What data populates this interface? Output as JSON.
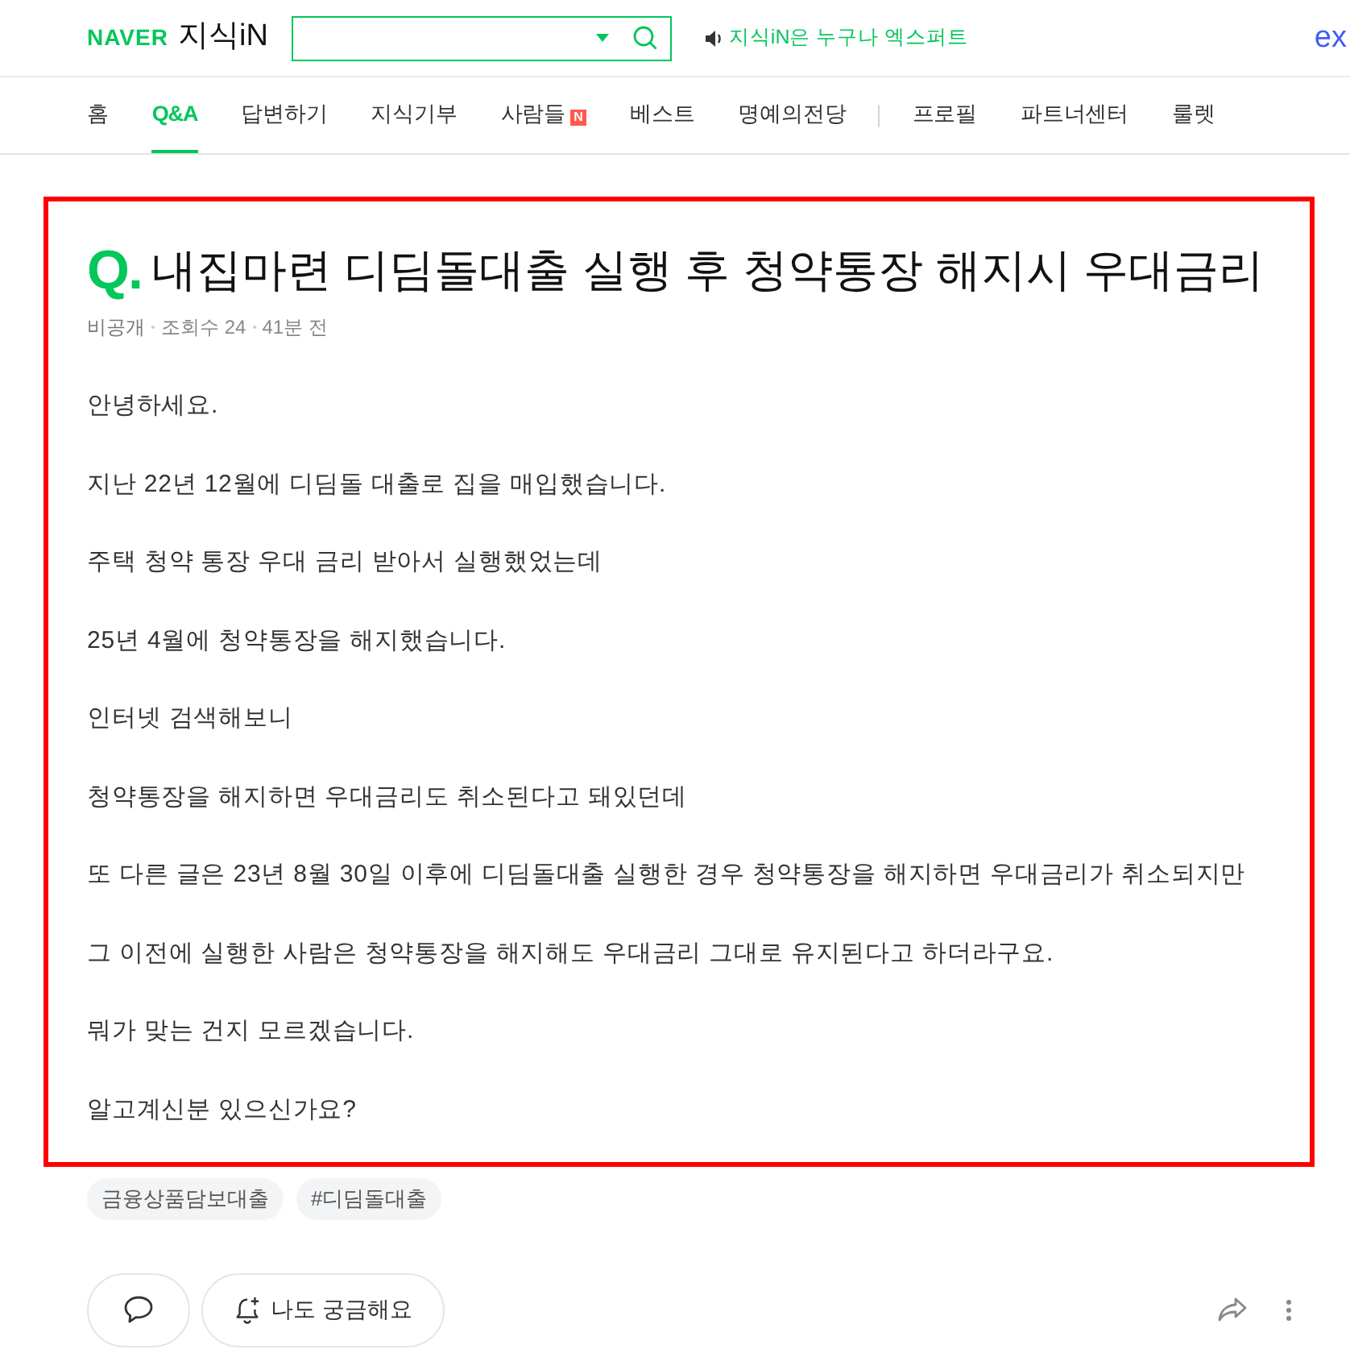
{
  "header": {
    "logo": "NAVER",
    "service": "지식iN",
    "notice": "지식iN은 누구나 엑스퍼트",
    "corner_logo": "ex"
  },
  "nav": {
    "groups": [
      [
        {
          "label": "홈",
          "selected": false
        },
        {
          "label": "Q&A",
          "selected": true
        },
        {
          "label": "답변하기",
          "selected": false
        },
        {
          "label": "지식기부",
          "selected": false
        },
        {
          "label": "사람들",
          "selected": false,
          "badge": "N"
        },
        {
          "label": "베스트",
          "selected": false
        },
        {
          "label": "명예의전당",
          "selected": false
        }
      ],
      [
        {
          "label": "프로필",
          "selected": false
        },
        {
          "label": "파트너센터",
          "selected": false
        },
        {
          "label": "룰렛",
          "selected": false
        }
      ]
    ]
  },
  "question": {
    "highlighted": true,
    "marker": "Q.",
    "title": "내집마련 디딤돌대출 실행 후 청약통장 해지시 우대금리",
    "meta": [
      "비공개",
      "조회수 24",
      "41분 전"
    ],
    "paragraphs": [
      "안녕하세요.",
      "지난 22년 12월에 디딤돌 대출로 집을 매입했습니다.",
      "주택 청약 통장 우대 금리 받아서 실행했었는데",
      "25년 4월에 청약통장을 해지했습니다.",
      "인터넷 검색해보니",
      "청약통장을 해지하면 우대금리도 취소된다고 돼있던데",
      "또 다른 글은 23년 8월 30일 이후에 디딤돌대출 실행한 경우 청약통장을 해지하면 우대금리가 취소되지만",
      "그 이전에 실행한 사람은 청약통장을 해지해도 우대금리 그대로 유지된다고 하더라구요.",
      "뭐가 맞는 건지 모르겠습니다.",
      "알고계신분 있으신가요?"
    ],
    "tags": [
      "금융상품담보대출",
      "#디딤돌대출"
    ]
  },
  "actions": {
    "curious_button": "나도 궁금해요"
  }
}
